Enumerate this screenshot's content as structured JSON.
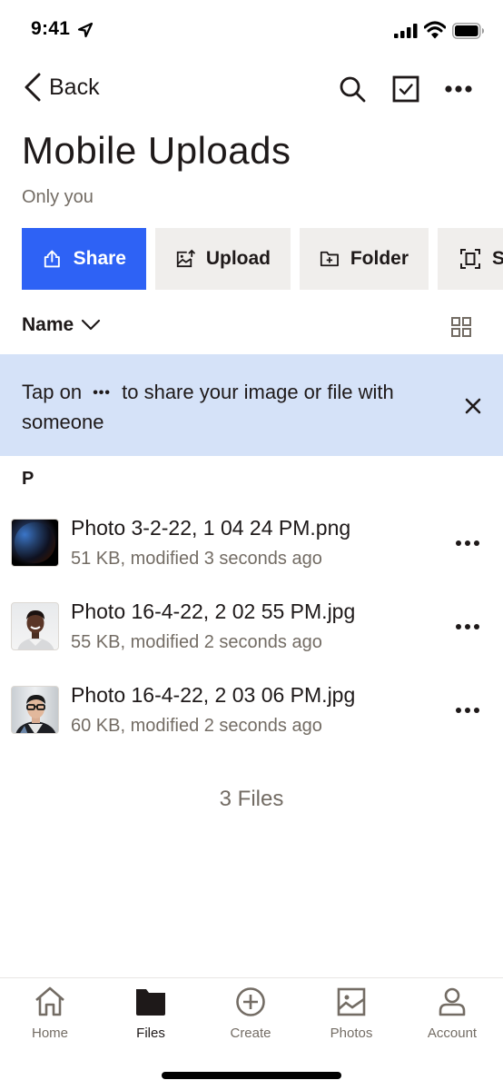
{
  "status_bar": {
    "time": "9:41"
  },
  "nav": {
    "back_label": "Back",
    "icons": [
      "search-icon",
      "select-checkbox-icon",
      "more-horizontal-icon"
    ]
  },
  "header": {
    "title": "Mobile Uploads",
    "subtitle": "Only you"
  },
  "actions": [
    {
      "label": "Share",
      "icon": "share-icon",
      "primary": true
    },
    {
      "label": "Upload",
      "icon": "upload-image-icon"
    },
    {
      "label": "Folder",
      "icon": "new-folder-icon"
    },
    {
      "label": "S",
      "icon": "scan-icon"
    }
  ],
  "sort": {
    "label": "Name",
    "view_icon": "grid-view-icon"
  },
  "banner": {
    "text_before": "Tap on",
    "dots": "•••",
    "text_after": "to share your image or file with someone"
  },
  "section": {
    "letter": "P"
  },
  "files": [
    {
      "name": "Photo 3-2-22, 1 04 24 PM.png",
      "meta": "51 KB, modified 3 seconds ago"
    },
    {
      "name": "Photo 16-4-22, 2 02 55 PM.jpg",
      "meta": "55 KB, modified 2 seconds ago"
    },
    {
      "name": "Photo 16-4-22, 2 03 06 PM.jpg",
      "meta": "60 KB, modified 2 seconds ago"
    }
  ],
  "file_count": "3 Files",
  "tabs": [
    {
      "label": "Home",
      "icon": "home-icon"
    },
    {
      "label": "Files",
      "icon": "folder-icon",
      "active": true
    },
    {
      "label": "Create",
      "icon": "plus-circle-icon"
    },
    {
      "label": "Photos",
      "icon": "photos-icon"
    },
    {
      "label": "Account",
      "icon": "account-icon"
    }
  ],
  "colors": {
    "primary": "#2e62f5",
    "banner_bg": "#d5e2f8",
    "secondary_button_bg": "#f0eeec",
    "text": "#1e1919",
    "muted_text": "#736c64"
  }
}
